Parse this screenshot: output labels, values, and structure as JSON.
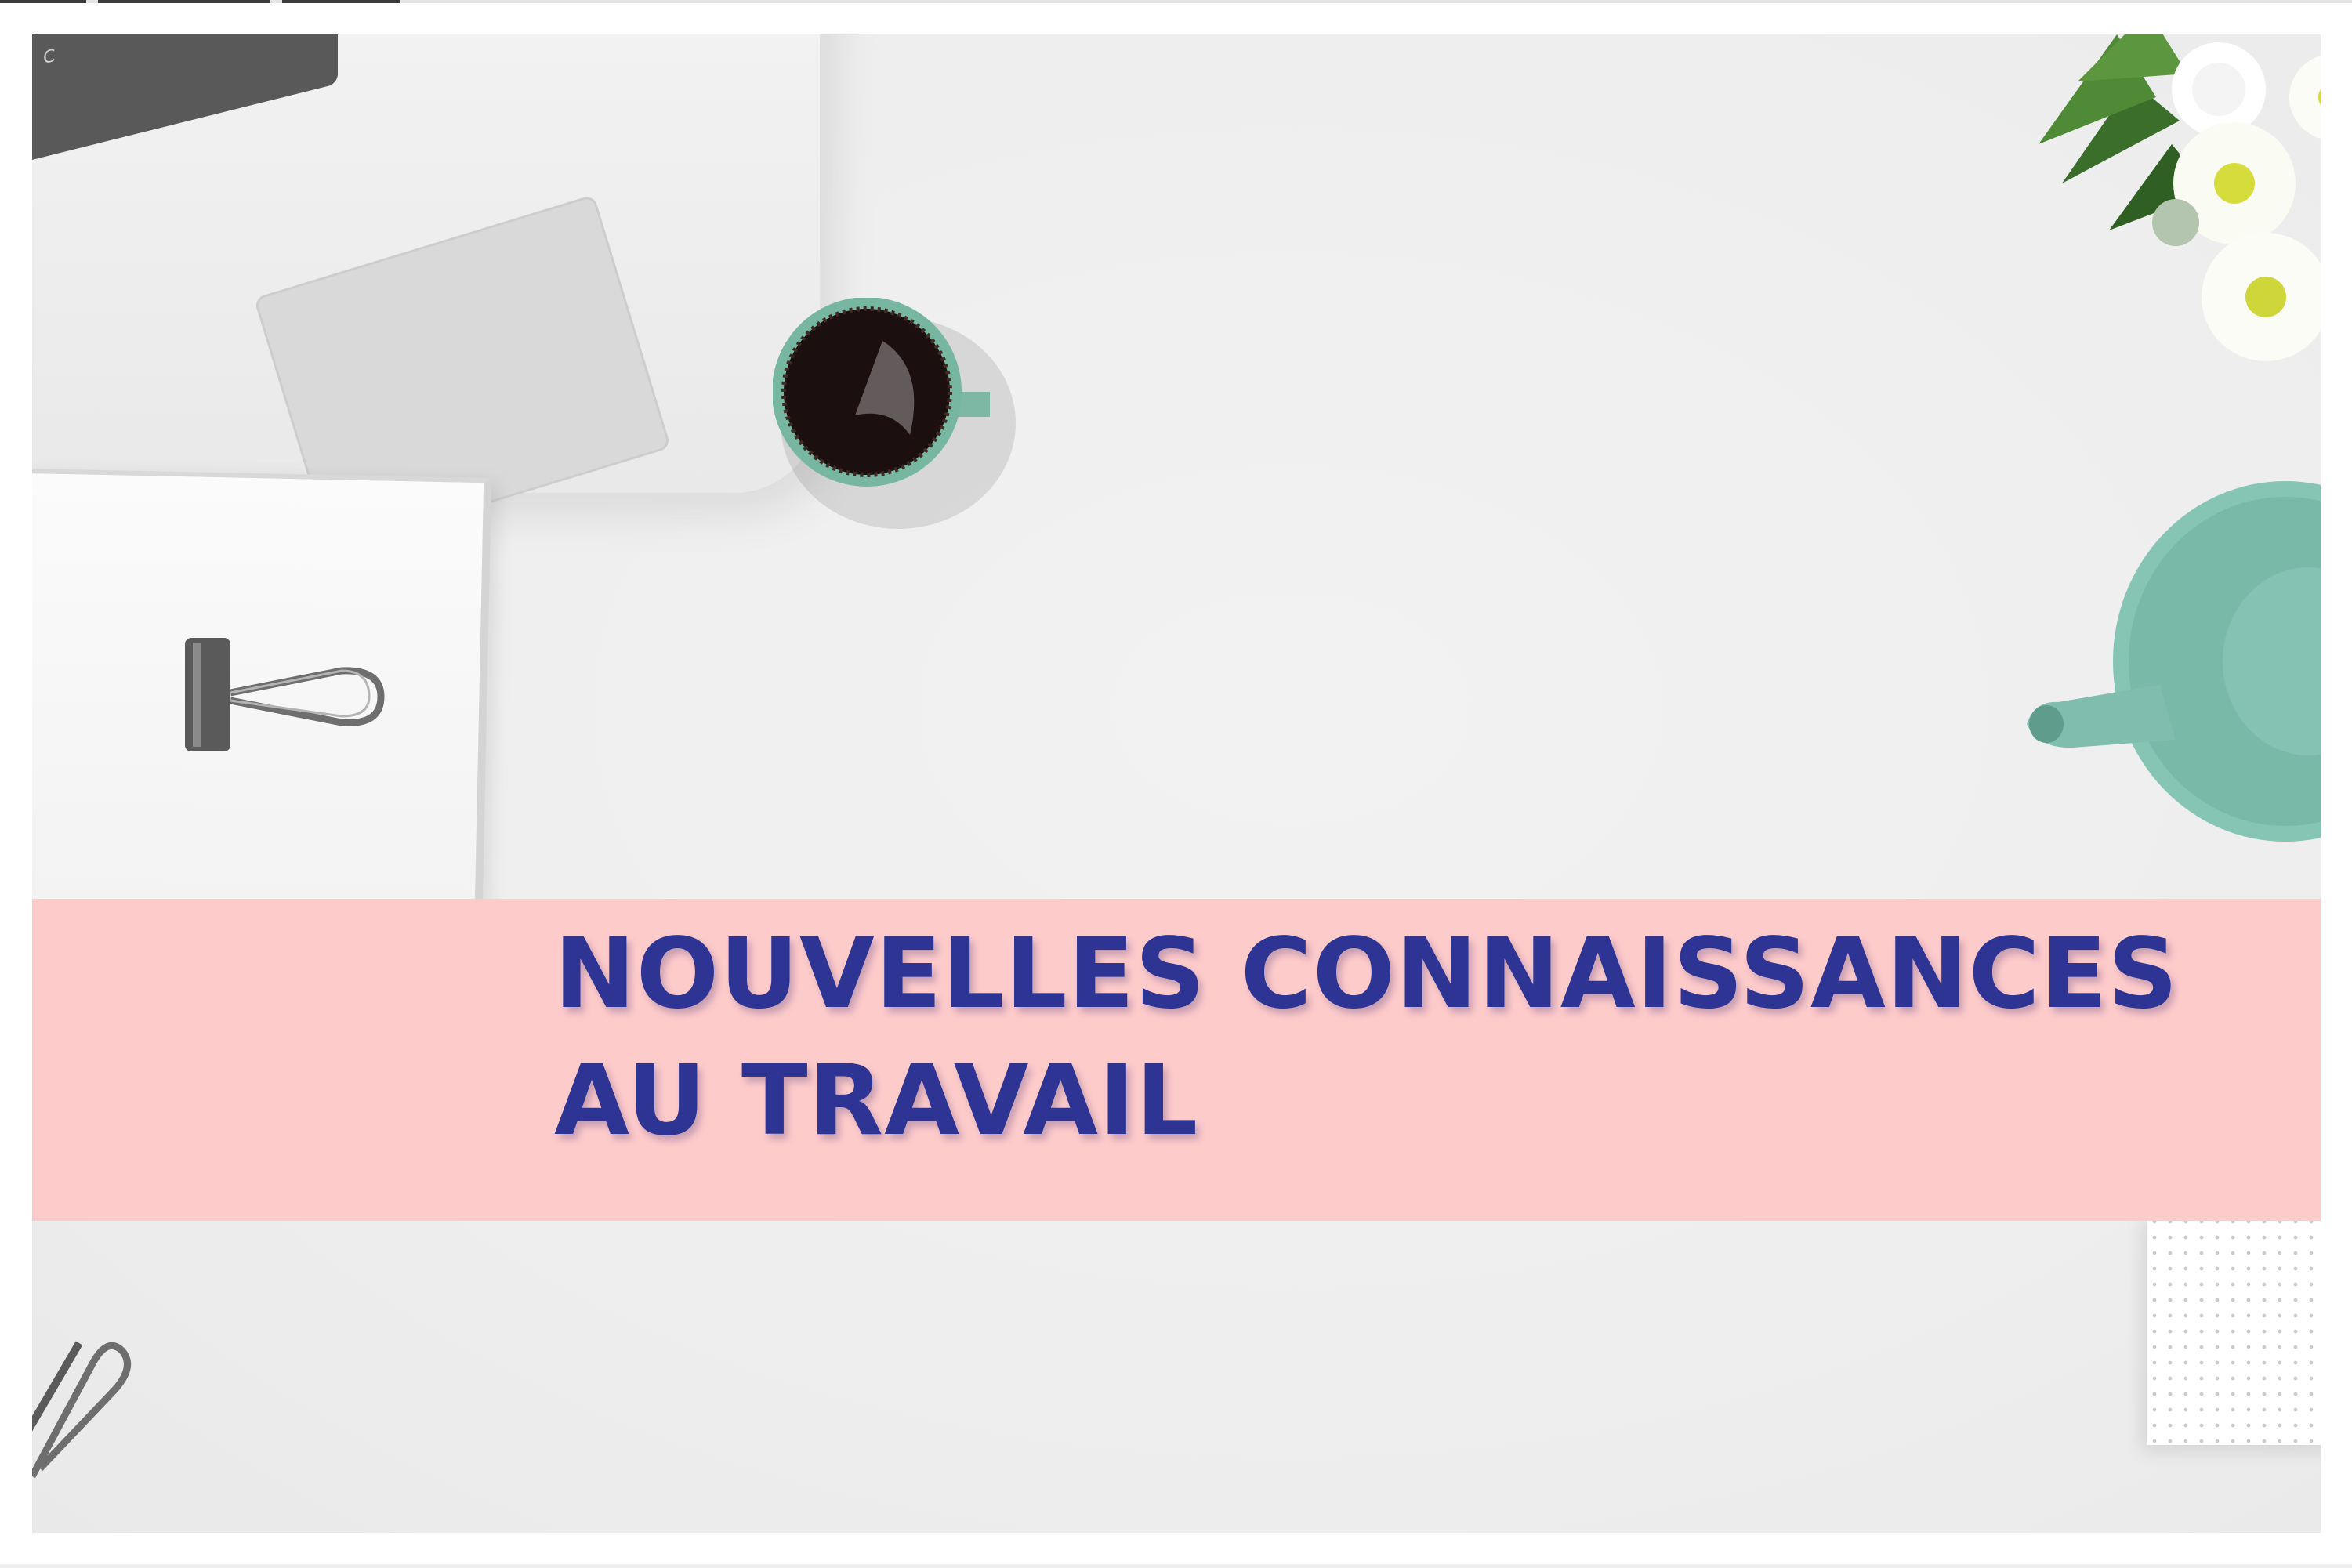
{
  "hero": {
    "title_line_1": "NOUVELLES CONNAISSANCES",
    "title_line_2": "AU TRAVAIL"
  },
  "colors": {
    "banner": "#fecbcb",
    "title_text": "#2d3494",
    "background": "#eeeeee"
  },
  "laptop": {
    "key_label": "C"
  }
}
